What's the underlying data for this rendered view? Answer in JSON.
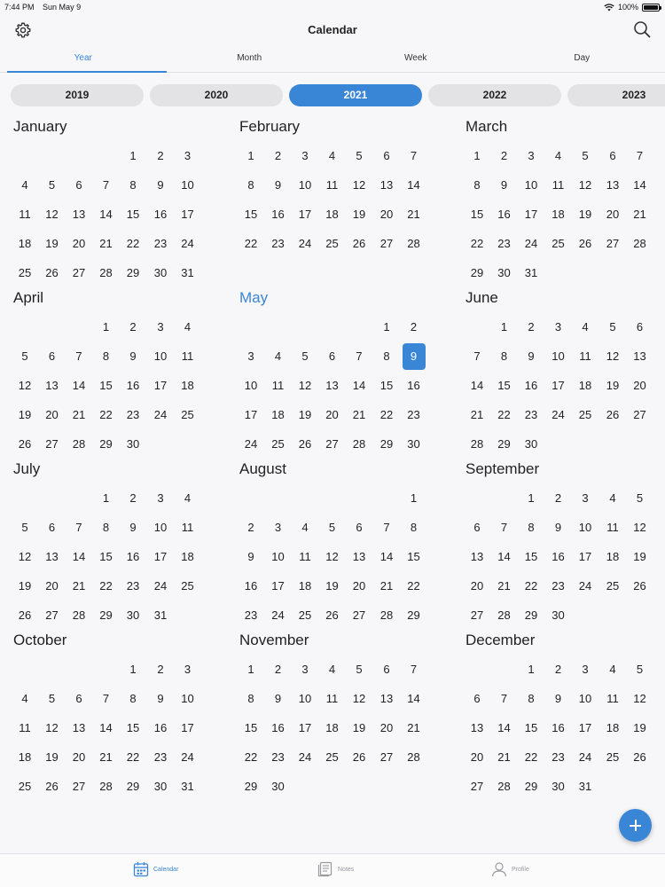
{
  "status": {
    "time": "7:44 PM",
    "date": "Sun May 9",
    "battery": "100%"
  },
  "header": {
    "title": "Calendar"
  },
  "tabs": [
    "Year",
    "Month",
    "Week",
    "Day"
  ],
  "years": [
    "2019",
    "2020",
    "2021",
    "2022",
    "2023"
  ],
  "selected_year": "2021",
  "today_label": "9",
  "months": [
    {
      "name": "January",
      "weeks": [
        [
          "",
          "",
          "",
          "",
          "1",
          "2",
          "3"
        ],
        [
          "4",
          "5",
          "6",
          "7",
          "8",
          "9",
          "10"
        ],
        [
          "11",
          "12",
          "13",
          "14",
          "15",
          "16",
          "17"
        ],
        [
          "18",
          "19",
          "20",
          "21",
          "22",
          "23",
          "24"
        ],
        [
          "25",
          "26",
          "27",
          "28",
          "29",
          "30",
          "31"
        ]
      ]
    },
    {
      "name": "February",
      "weeks": [
        [
          "1",
          "2",
          "3",
          "4",
          "5",
          "6",
          "7"
        ],
        [
          "8",
          "9",
          "10",
          "11",
          "12",
          "13",
          "14"
        ],
        [
          "15",
          "16",
          "17",
          "18",
          "19",
          "20",
          "21"
        ],
        [
          "22",
          "23",
          "24",
          "25",
          "26",
          "27",
          "28"
        ]
      ]
    },
    {
      "name": "March",
      "weeks": [
        [
          "1",
          "2",
          "3",
          "4",
          "5",
          "6",
          "7"
        ],
        [
          "8",
          "9",
          "10",
          "11",
          "12",
          "13",
          "14"
        ],
        [
          "15",
          "16",
          "17",
          "18",
          "19",
          "20",
          "21"
        ],
        [
          "22",
          "23",
          "24",
          "25",
          "26",
          "27",
          "28"
        ],
        [
          "29",
          "30",
          "31",
          "",
          "",
          "",
          ""
        ]
      ]
    },
    {
      "name": "April",
      "weeks": [
        [
          "",
          "",
          "",
          "1",
          "2",
          "3",
          "4"
        ],
        [
          "5",
          "6",
          "7",
          "8",
          "9",
          "10",
          "11"
        ],
        [
          "12",
          "13",
          "14",
          "15",
          "16",
          "17",
          "18"
        ],
        [
          "19",
          "20",
          "21",
          "22",
          "23",
          "24",
          "25"
        ],
        [
          "26",
          "27",
          "28",
          "29",
          "30",
          "",
          ""
        ]
      ]
    },
    {
      "name": "May",
      "weeks": [
        [
          "",
          "",
          "",
          "",
          "",
          "1",
          "2"
        ],
        [
          "3",
          "4",
          "5",
          "6",
          "7",
          "8",
          "9"
        ],
        [
          "10",
          "11",
          "12",
          "13",
          "14",
          "15",
          "16"
        ],
        [
          "17",
          "18",
          "19",
          "20",
          "21",
          "22",
          "23"
        ],
        [
          "24",
          "25",
          "26",
          "27",
          "28",
          "29",
          "30"
        ]
      ]
    },
    {
      "name": "June",
      "weeks": [
        [
          "",
          "1",
          "2",
          "3",
          "4",
          "5",
          "6"
        ],
        [
          "7",
          "8",
          "9",
          "10",
          "11",
          "12",
          "13"
        ],
        [
          "14",
          "15",
          "16",
          "17",
          "18",
          "19",
          "20"
        ],
        [
          "21",
          "22",
          "23",
          "24",
          "25",
          "26",
          "27"
        ],
        [
          "28",
          "29",
          "30",
          "",
          "",
          "",
          ""
        ]
      ]
    },
    {
      "name": "July",
      "weeks": [
        [
          "",
          "",
          "",
          "1",
          "2",
          "3",
          "4"
        ],
        [
          "5",
          "6",
          "7",
          "8",
          "9",
          "10",
          "11"
        ],
        [
          "12",
          "13",
          "14",
          "15",
          "16",
          "17",
          "18"
        ],
        [
          "19",
          "20",
          "21",
          "22",
          "23",
          "24",
          "25"
        ],
        [
          "26",
          "27",
          "28",
          "29",
          "30",
          "31",
          ""
        ]
      ]
    },
    {
      "name": "August",
      "weeks": [
        [
          "",
          "",
          "",
          "",
          "",
          "",
          "1"
        ],
        [
          "2",
          "3",
          "4",
          "5",
          "6",
          "7",
          "8"
        ],
        [
          "9",
          "10",
          "11",
          "12",
          "13",
          "14",
          "15"
        ],
        [
          "16",
          "17",
          "18",
          "19",
          "20",
          "21",
          "22"
        ],
        [
          "23",
          "24",
          "25",
          "26",
          "27",
          "28",
          "29"
        ]
      ]
    },
    {
      "name": "September",
      "weeks": [
        [
          "",
          "",
          "1",
          "2",
          "3",
          "4",
          "5"
        ],
        [
          "6",
          "7",
          "8",
          "9",
          "10",
          "11",
          "12"
        ],
        [
          "13",
          "14",
          "15",
          "16",
          "17",
          "18",
          "19"
        ],
        [
          "20",
          "21",
          "22",
          "23",
          "24",
          "25",
          "26"
        ],
        [
          "27",
          "28",
          "29",
          "30",
          "",
          "",
          ""
        ]
      ]
    },
    {
      "name": "October",
      "weeks": [
        [
          "",
          "",
          "",
          "",
          "1",
          "2",
          "3"
        ],
        [
          "4",
          "5",
          "6",
          "7",
          "8",
          "9",
          "10"
        ],
        [
          "11",
          "12",
          "13",
          "14",
          "15",
          "16",
          "17"
        ],
        [
          "18",
          "19",
          "20",
          "21",
          "22",
          "23",
          "24"
        ],
        [
          "25",
          "26",
          "27",
          "28",
          "29",
          "30",
          "31"
        ]
      ]
    },
    {
      "name": "November",
      "weeks": [
        [
          "1",
          "2",
          "3",
          "4",
          "5",
          "6",
          "7"
        ],
        [
          "8",
          "9",
          "10",
          "11",
          "12",
          "13",
          "14"
        ],
        [
          "15",
          "16",
          "17",
          "18",
          "19",
          "20",
          "21"
        ],
        [
          "22",
          "23",
          "24",
          "25",
          "26",
          "27",
          "28"
        ],
        [
          "29",
          "30",
          "",
          "",
          "",
          "",
          ""
        ]
      ]
    },
    {
      "name": "December",
      "weeks": [
        [
          "",
          "",
          "1",
          "2",
          "3",
          "4",
          "5"
        ],
        [
          "6",
          "7",
          "8",
          "9",
          "10",
          "11",
          "12"
        ],
        [
          "13",
          "14",
          "15",
          "16",
          "17",
          "18",
          "19"
        ],
        [
          "20",
          "21",
          "22",
          "23",
          "24",
          "25",
          "26"
        ],
        [
          "27",
          "28",
          "29",
          "30",
          "31",
          "",
          ""
        ]
      ]
    }
  ],
  "current_month": "May",
  "bottom_tabs": {
    "calendar": "Calendar",
    "notes": "Notes",
    "profile": "Profile"
  },
  "icons": {
    "settings": "gear-icon",
    "search": "search-icon",
    "add": "plus-icon",
    "calendar": "calendar-icon",
    "notes": "notes-icon",
    "profile": "profile-icon",
    "wifi": "wifi-icon",
    "battery": "battery-icon"
  },
  "colors": {
    "accent": "#3a86d6",
    "background": "#f7f7f9",
    "pill": "#e3e3e6"
  }
}
